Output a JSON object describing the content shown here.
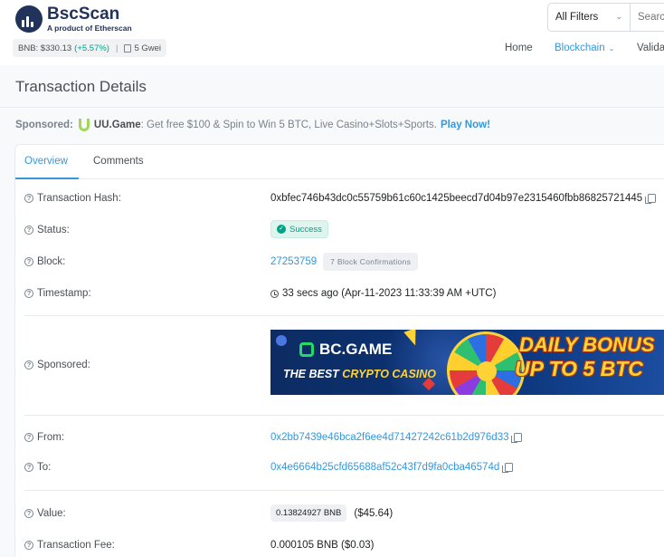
{
  "header": {
    "brand_title": "BscScan",
    "brand_sub": "A product of Etherscan",
    "price_label": "BNB: $330.13",
    "price_change": "(+5.57%)",
    "gas": "5 Gwei",
    "filter_label": "All Filters",
    "search_placeholder": "Search",
    "nav": {
      "home": "Home",
      "blockchain": "Blockchain",
      "validators": "Validators"
    }
  },
  "page": {
    "title": "Transaction Details",
    "sponsored_label": "Sponsored:",
    "sponsored_brand": "UU.Game",
    "sponsored_text": ": Get free $100 & Spin to Win 5 BTC, Live Casino+Slots+Sports.",
    "sponsored_cta": "Play Now!"
  },
  "tabs": {
    "overview": "Overview",
    "comments": "Comments"
  },
  "details": {
    "tx_hash_label": "Transaction Hash:",
    "tx_hash": "0xbfec746b43dc0c55759b61c60c1425beecd7d04b97e2315460fbb86825721445",
    "status_label": "Status:",
    "status": "Success",
    "block_label": "Block:",
    "block": "27253759",
    "confirmations": "7 Block Confirmations",
    "timestamp_label": "Timestamp:",
    "timestamp": "33 secs ago (Apr-11-2023 11:33:39 AM +UTC)",
    "sponsored_label": "Sponsored:",
    "from_label": "From:",
    "from": "0x2bb7439e46bca2f6ee4d71427242c61b2d976d33",
    "to_label": "To:",
    "to": "0x4e6664b25cfd65688af52c43f7d9fa0cba46574d",
    "value_label": "Value:",
    "value": "0.13824927 BNB",
    "value_usd": "($45.64)",
    "fee_label": "Transaction Fee:",
    "fee": "0.000105 BNB ($0.03)"
  },
  "banner": {
    "brand": "BC.GAME",
    "tag_a": "THE BEST ",
    "tag_b": "CRYPTO CASINO",
    "bonus_line1": "DAILY BONUS",
    "bonus_line2": "UP TO 5 BTC"
  },
  "colors": {
    "link": "#3498db",
    "success": "#00a186",
    "brand_dark": "#21325b",
    "brand_gold": "#f0b90b"
  }
}
